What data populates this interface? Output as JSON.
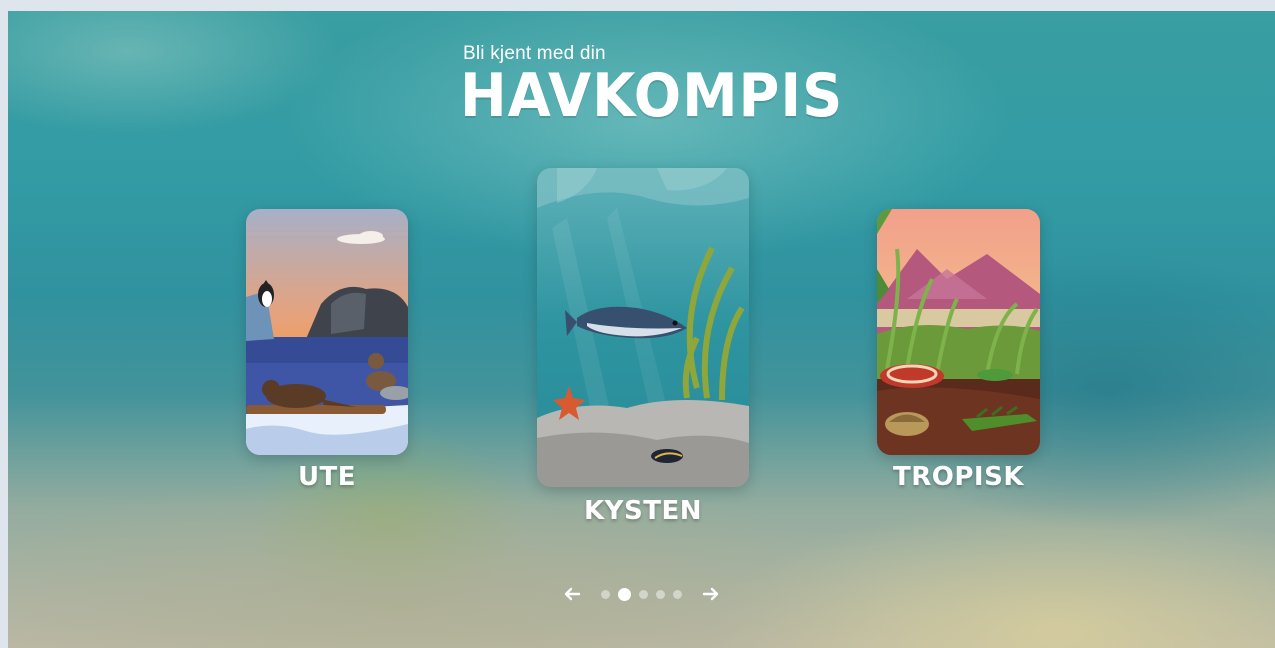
{
  "header": {
    "subtitle": "Bli kjent med din",
    "title": "HAVKOMPIS"
  },
  "carousel": {
    "cards": [
      {
        "id": "ute",
        "label": "UTE"
      },
      {
        "id": "kysten",
        "label": "KYSTEN"
      },
      {
        "id": "tropisk",
        "label": "TROPISK"
      }
    ],
    "active_index": 1,
    "page_count": 5
  },
  "icons": {
    "prev": "arrow-left-icon",
    "next": "arrow-right-icon"
  },
  "colors": {
    "text": "#ffffff",
    "background_teal": "#2f9aa3"
  }
}
